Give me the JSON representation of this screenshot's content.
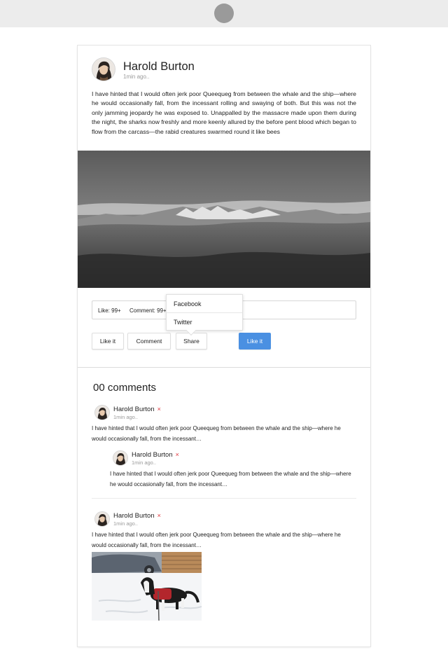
{
  "post": {
    "author": "Harold Burton",
    "time": "1min ago..",
    "text": "I have hinted that I would often jerk poor Queequeg from between the whale and the ship—where he would occasionally fall, from the incessant rolling and swaying of both. But this was not the only jamming jeopardy he was exposed to. Unappalled by the massacre made upon them during the night, the sharks now freshly and more keenly allured by the before pent blood which began to flow from the carcass—the rabid creatures swarmed round it like bees",
    "photo_icon": "mountain-landscape-photo",
    "stats": {
      "likes": "Like: 99+",
      "comments": "Comment: 99+"
    },
    "actions": {
      "like": "Like it",
      "comment": "Comment",
      "share": "Share",
      "primary_like": "Like it"
    },
    "share_menu": [
      "Facebook",
      "Twitter"
    ]
  },
  "comments_section": {
    "heading": "00 comments",
    "items": [
      {
        "author": "Harold Burton",
        "delete_icon": "×",
        "time": "1min ago..",
        "text": "I have hinted that I would often jerk poor Queequeg from between the whale and the ship—where he would occasionally fall, from the incessant…"
      },
      {
        "author": "Harold Burton",
        "delete_icon": "×",
        "time": "1min ago..",
        "text": "I have hinted that I would often jerk poor Queequeg from between the whale and the ship—where he would occasionally fall, from the incessant…"
      },
      {
        "author": "Harold Burton",
        "delete_icon": "×",
        "time": "1min ago..",
        "text": "I have hinted that I would often jerk poor Queequeg from between the whale and the ship—where he would occasionally fall, from the incessant…",
        "photo_icon": "dog-in-snow-photo"
      }
    ]
  },
  "colors": {
    "primary": "#4a90e2",
    "delete": "#e0353c",
    "muted": "#9a9a9a",
    "topbar": "#ececec"
  }
}
